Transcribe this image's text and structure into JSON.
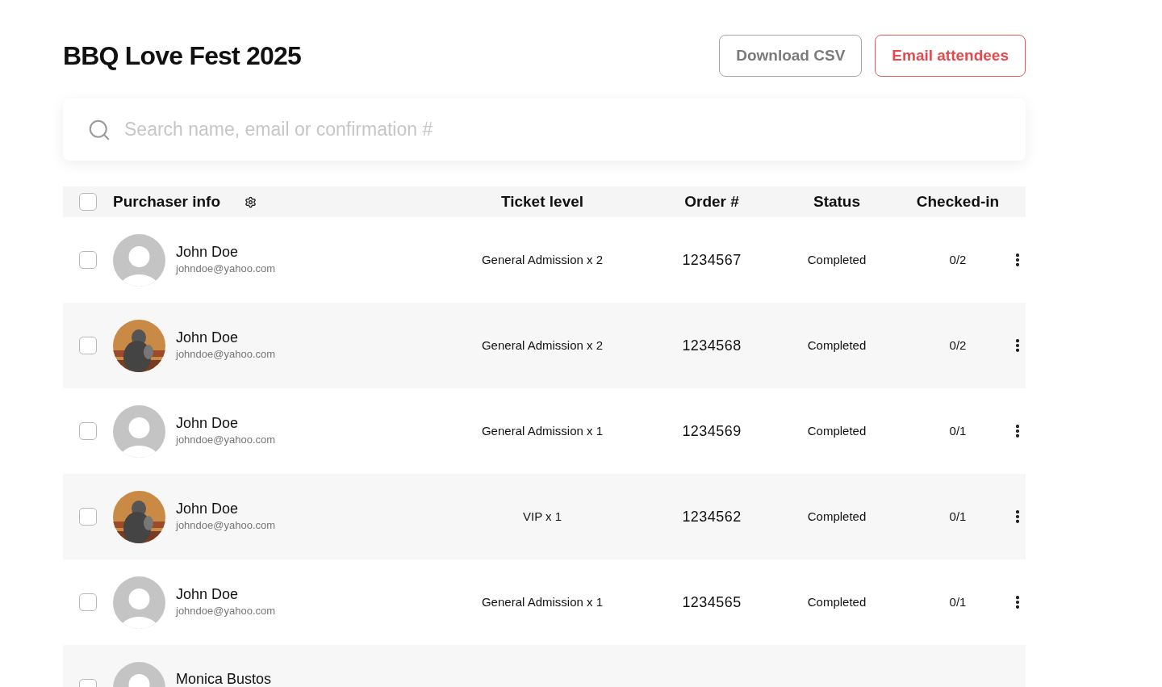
{
  "title": "BBQ Love Fest 2025",
  "actions": [
    {
      "label": "Download CSV",
      "kind": "secondary"
    },
    {
      "label": "Email attendees",
      "kind": "primary"
    }
  ],
  "search": {
    "placeholder": "Search name, email or confirmation #"
  },
  "table": {
    "select_all": {
      "checked": false
    },
    "columns": [
      "Purchaser info",
      "Ticket level",
      "Order #",
      "Status",
      "Checked-in"
    ],
    "rows": [
      {
        "checked": false,
        "avatar": {
          "kind": "placeholder"
        },
        "name": "John Doe",
        "email": "johndoe@yahoo.com",
        "ticket": "General Admission x 2",
        "order": "1234567",
        "status": "Completed",
        "checked_in": "0/2"
      },
      {
        "checked": false,
        "name": "John Doe",
        "email": "johndoe@yahoo.com",
        "ticket": "General Admission x 2",
        "order": "1234568",
        "status": "Completed",
        "checked_in": "0/2"
      },
      {
        "checked": false,
        "avatar": {
          "kind": "placeholder"
        },
        "name": "John Doe",
        "email": "johndoe@yahoo.com",
        "ticket": "General Admission x 1",
        "order": "1234569",
        "status": "Completed",
        "checked_in": "0/1"
      },
      {
        "checked": false,
        "name": "John Doe",
        "email": "johndoe@yahoo.com",
        "ticket": "VIP x 1",
        "order": "1234562",
        "status": "Completed",
        "checked_in": "0/1"
      },
      {
        "checked": false,
        "avatar": {
          "kind": "placeholder"
        },
        "name": "John Doe",
        "email": "johndoe@yahoo.com",
        "ticket": "General Admission x 1",
        "order": "1234565",
        "status": "Completed",
        "checked_in": "0/1"
      },
      {
        "checked": false,
        "avatar": {
          "kind": "placeholder"
        },
        "name": "Monica Bustos"
      }
    ]
  }
}
